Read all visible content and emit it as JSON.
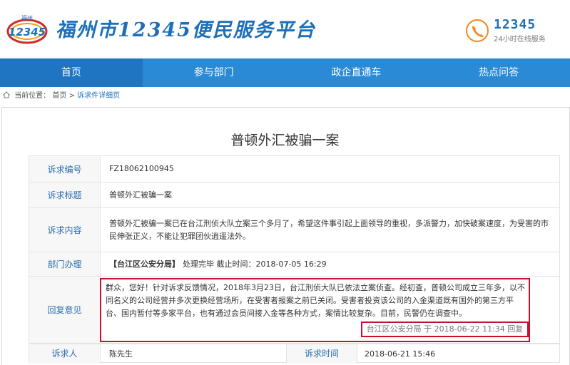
{
  "header": {
    "logo_text": "12345",
    "logo_small": "福州",
    "site_title": "福州市12345便民服务平台",
    "hotline_number": "12345",
    "hotline_sub": "24小时在线服务"
  },
  "nav": {
    "items": [
      {
        "label": "首页"
      },
      {
        "label": "参与部门"
      },
      {
        "label": "政企直通车"
      },
      {
        "label": "热点问答"
      }
    ]
  },
  "breadcrumb": {
    "prefix": "当前位置：",
    "home": "首页",
    "sep": " > ",
    "current": "诉求件详细页"
  },
  "case": {
    "title": "普顿外汇被骗一案",
    "fields": {
      "id_label": "诉求编号",
      "id_value": "FZ18062100945",
      "title_label": "诉求标题",
      "title_value": "普顿外汇被骗一案",
      "content_label": "诉求内容",
      "content_value": "普顿外汇被骗一案已在台江刑侦大队立案三个多月了，希望这件事引起上面领导的重视，多派警力，加快破案速度，为受害的市民伸张正义，不能让犯罪团伙逍遥法外。",
      "dept_label": "部门办理",
      "dept_name": "【台江区公安分局】",
      "dept_status": "处理完毕 截止时间：2018-07-05 16:29",
      "reply_label": "回复意见",
      "reply_text": "群众，您好！针对诉求反馈情况，2018年3月23日，台江刑侦大队已依法立案侦查。经初查，普顿公司成立三年多，以不同名义的公司经营并多次更换经营场所，在受害者报案之前已关闭。受害者投资该公司的入金渠道既有国外的第三方平台、国内暂付等多家平台，也有通过会员间接入金等各种方式，案情比较复杂。目前，民警仍在调查中。",
      "reply_meta": "台江区公安分局 于 2018-06-22 11:34 回复",
      "requester_label": "诉求人",
      "requester_value": "陈先生",
      "time_label": "诉求时间",
      "time_value": "2018-06-21 15:46"
    }
  },
  "colors": {
    "brand_blue": "#1d6fb8",
    "nav_blue": "#2b8ad6",
    "highlight_red": "#c8102e"
  }
}
